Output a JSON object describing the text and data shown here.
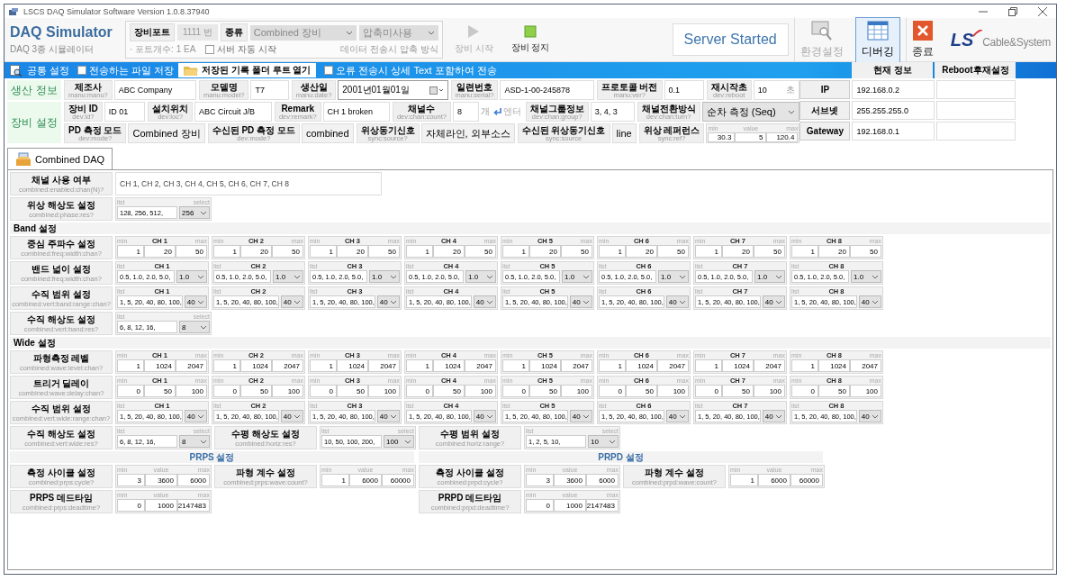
{
  "window": {
    "title": "LSCS DAQ Simulator Software Version 1.0.8.37940"
  },
  "header": {
    "app_title": "DAQ Simulator",
    "app_subtitle": "DAQ 3종 시뮬레이터",
    "port_label": "장비포트",
    "port_value": "1111 번",
    "kind_label": "종류",
    "kind_value": "Combined 장비",
    "compress_value": "압축미사용",
    "port_count": "· 포트개수: 1 EA",
    "auto_start": {
      "label": "서버 자동 시작",
      "checked": false
    },
    "compress_hint": "데이터 전송시 압축 방식",
    "device_buttons": [
      {
        "kind": "start",
        "label": "장비 시작",
        "disabled": true
      },
      {
        "kind": "stop",
        "label": "장비 정지",
        "disabled": false
      }
    ],
    "status": "Server Started",
    "tools": [
      {
        "kind": "settings",
        "label": "환경설정",
        "disabled": true,
        "selected": false
      },
      {
        "kind": "debug",
        "label": "디버깅",
        "disabled": false,
        "selected": true
      },
      {
        "kind": "exit",
        "label": "종료",
        "disabled": false,
        "selected": false
      }
    ],
    "logo": {
      "mark": "LS",
      "text": "Cable&System"
    }
  },
  "toolbar": {
    "title": "공통 설정",
    "save_files": {
      "label": "전송하는 파일 저장",
      "checked": false
    },
    "open_folder": "저장된 기록 폴더 루트 열기",
    "include_text": {
      "label": "오류 전송시 상세 Text 포함하여 전송",
      "checked": false
    }
  },
  "info": {
    "sections": [
      {
        "title": "생산 정보",
        "lines": [
          {
            "fields": [
              {
                "label": "제조사",
                "cmd": "manu:manu?",
                "kind": "text",
                "value": "ABC Company"
              },
              {
                "label": "모델명",
                "cmd": "manu:model?",
                "kind": "text",
                "value": "T7"
              },
              {
                "label": "생산일",
                "cmd": "manu:date?",
                "kind": "date",
                "value": "2001년01월01일"
              },
              {
                "label": "일련번호",
                "cmd": "manu:serial?",
                "kind": "text",
                "value": "ASD-1-00-245878"
              },
              {
                "label": "프로토콜 버전",
                "cmd": "manu:ver?",
                "kind": "text",
                "value": "0.1"
              },
              {
                "label": "재시작초",
                "cmd": "dev:reboot",
                "kind": "unit",
                "value": "10",
                "unit": "초"
              }
            ]
          }
        ]
      },
      {
        "title": "장비 설정",
        "lines": [
          {
            "fields": [
              {
                "label": "장비 ID",
                "cmd": "dev:id?",
                "kind": "text",
                "value": "ID 01"
              },
              {
                "label": "설치위치",
                "cmd": "dev:loc?",
                "kind": "text",
                "value": "ABC Circuit J/B"
              },
              {
                "label": "Remark",
                "cmd": "dev:remark?",
                "kind": "text",
                "value": "CH 1 broken"
              },
              {
                "label": "채널수",
                "cmd": "dev:chan:count?",
                "kind": "count",
                "value": "8",
                "unit": "개",
                "enter": "엔터"
              },
              {
                "label": "채널그룹정보",
                "cmd": "dev:chan:group?",
                "kind": "text",
                "value": "3, 4, 3"
              },
              {
                "label": "채널전환방식",
                "cmd": "dev:chan:turn?",
                "kind": "select",
                "value": "순차 측정 (Seq)"
              }
            ]
          },
          {
            "fields": [
              {
                "label": "PD 측정 모드",
                "cmd": "dev:mode?",
                "kind": "readonly",
                "value": "Combined 장비"
              },
              {
                "label": "수신된 PD 측정 모드",
                "cmd": "dev:mode?",
                "kind": "readonly",
                "value": "combined"
              },
              {
                "label": "위상동기신호",
                "cmd": "sync:source?",
                "kind": "readonly",
                "value": "자체라인, 외부소스"
              },
              {
                "label": "수신된 위상동기신호",
                "cmd": "sync:source",
                "kind": "readonly",
                "value": "line"
              },
              {
                "label": "위상 레퍼런스",
                "cmd": "sync:ref?",
                "kind": "range",
                "widget": {
                  "kind": "range",
                  "captions": [
                    "min",
                    "value",
                    "max"
                  ],
                  "values": [
                    "30.3",
                    "5",
                    "120.4"
                  ]
                }
              }
            ]
          }
        ]
      }
    ]
  },
  "network": {
    "columns": [
      "현재 정보",
      "Reboot후재설정"
    ],
    "rows": [
      {
        "label": "IP",
        "current": "192.168.0.2"
      },
      {
        "label": "서브넷",
        "current": "255.255.255.0"
      },
      {
        "label": "Gateway",
        "current": "192.168.0.1"
      }
    ]
  },
  "tabs": [
    {
      "label": "Combined DAQ",
      "selected": true
    }
  ],
  "combined": {
    "blocks": [
      {
        "kind": "text",
        "label": "채널 사용 여부",
        "cmd": "combined:enabled:chan(N)?",
        "value": "CH 1, CH 2, CH 3, CH 4, CH 5, CH 6, CH 7, CH 8"
      },
      {
        "kind": "pairs",
        "pairs": [
          {
            "label": "위상 해상도 설정",
            "cmd": "combined:phase:res?",
            "widget": {
              "kind": "list",
              "captions": [
                "list",
                "select"
              ],
              "list": "128, 256, 512,",
              "select": "256"
            }
          }
        ]
      },
      {
        "kind": "heading",
        "title": "Band 설정"
      },
      {
        "kind": "channels",
        "label": "중심 주파수 설정",
        "cmd": "combined:freq:width:chan?",
        "channels": [
          {
            "kind": "range",
            "title": "CH 1",
            "captions": [
              "min",
              "max"
            ],
            "values": [
              "1",
              "20",
              "50"
            ]
          },
          {
            "kind": "range",
            "title": "CH 2",
            "captions": [
              "min",
              "max"
            ],
            "values": [
              "1",
              "20",
              "50"
            ]
          },
          {
            "kind": "range",
            "title": "CH 3",
            "captions": [
              "min",
              "max"
            ],
            "values": [
              "1",
              "20",
              "50"
            ]
          },
          {
            "kind": "range",
            "title": "CH 4",
            "captions": [
              "min",
              "max"
            ],
            "values": [
              "1",
              "20",
              "50"
            ]
          },
          {
            "kind": "range",
            "title": "CH 5",
            "captions": [
              "min",
              "max"
            ],
            "values": [
              "1",
              "20",
              "50"
            ]
          },
          {
            "kind": "range",
            "title": "CH 6",
            "captions": [
              "min",
              "max"
            ],
            "values": [
              "1",
              "20",
              "50"
            ]
          },
          {
            "kind": "range",
            "title": "CH 7",
            "captions": [
              "min",
              "max"
            ],
            "values": [
              "1",
              "20",
              "50"
            ]
          },
          {
            "kind": "range",
            "title": "CH 8",
            "captions": [
              "min",
              "max"
            ],
            "values": [
              "1",
              "20",
              "50"
            ]
          }
        ]
      },
      {
        "kind": "channels",
        "label": "밴드 넓이 설정",
        "cmd": "combined:freq:width:chan?",
        "channels": [
          {
            "kind": "list",
            "title": "CH 1",
            "captions": [
              "list"
            ],
            "list": "0.5, 1.0, 2.0, 5.0,",
            "select": "1.0"
          },
          {
            "kind": "list",
            "title": "CH 2",
            "captions": [
              "list"
            ],
            "list": "0.5, 1.0, 2.0, 5.0,",
            "select": "1.0"
          },
          {
            "kind": "list",
            "title": "CH 3",
            "captions": [
              "list"
            ],
            "list": "0.5, 1.0, 2.0, 5.0,",
            "select": "1.0"
          },
          {
            "kind": "list",
            "title": "CH 4",
            "captions": [
              "list"
            ],
            "list": "0.5, 1.0, 2.0, 5.0,",
            "select": "1.0"
          },
          {
            "kind": "list",
            "title": "CH 5",
            "captions": [
              "list"
            ],
            "list": "0.5, 1.0, 2.0, 5.0,",
            "select": "1.0"
          },
          {
            "kind": "list",
            "title": "CH 6",
            "captions": [
              "list"
            ],
            "list": "0.5, 1.0, 2.0, 5.0,",
            "select": "1.0"
          },
          {
            "kind": "list",
            "title": "CH 7",
            "captions": [
              "list"
            ],
            "list": "0.5, 1.0, 2.0, 5.0,",
            "select": "1.0"
          },
          {
            "kind": "list",
            "title": "CH 8",
            "captions": [
              "list"
            ],
            "list": "0.5, 1.0, 2.0, 5.0,",
            "select": "1.0"
          }
        ]
      },
      {
        "kind": "channels",
        "label": "수직 범위 설정",
        "cmd": "combined:vert:band:range:chan?",
        "channels": [
          {
            "kind": "list",
            "title": "CH 1",
            "captions": [
              "list"
            ],
            "list": "1, 5, 20, 40, 80, 100,",
            "select": "40"
          },
          {
            "kind": "list",
            "title": "CH 2",
            "captions": [
              "list"
            ],
            "list": "1, 5, 20, 40, 80, 100,",
            "select": "40"
          },
          {
            "kind": "list",
            "title": "CH 3",
            "captions": [
              "list"
            ],
            "list": "1, 5, 20, 40, 80, 100,",
            "select": "40"
          },
          {
            "kind": "list",
            "title": "CH 4",
            "captions": [
              "list"
            ],
            "list": "1, 5, 20, 40, 80, 100,",
            "select": "40"
          },
          {
            "kind": "list",
            "title": "CH 5",
            "captions": [
              "list"
            ],
            "list": "1, 5, 20, 40, 80, 100,",
            "select": "40"
          },
          {
            "kind": "list",
            "title": "CH 6",
            "captions": [
              "list"
            ],
            "list": "1, 5, 20, 40, 80, 100,",
            "select": "40"
          },
          {
            "kind": "list",
            "title": "CH 7",
            "captions": [
              "list"
            ],
            "list": "1, 5, 20, 40, 80, 100,",
            "select": "40"
          },
          {
            "kind": "list",
            "title": "CH 8",
            "captions": [
              "list"
            ],
            "list": "1, 5, 20, 40, 80, 100,",
            "select": "40"
          }
        ]
      },
      {
        "kind": "pairs",
        "pairs": [
          {
            "label": "수직 해상도 설정",
            "cmd": "combined:vert:band:res?",
            "widget": {
              "kind": "list",
              "captions": [
                "list",
                "select"
              ],
              "list": "6, 8, 12, 16,",
              "select": "8"
            }
          }
        ]
      },
      {
        "kind": "heading",
        "title": "Wide 설정"
      },
      {
        "kind": "channels",
        "label": "파형측정 레벨",
        "cmd": "combined:wave:level:chan?",
        "channels": [
          {
            "kind": "range",
            "title": "CH 1",
            "captions": [
              "min",
              "max"
            ],
            "values": [
              "1",
              "1024",
              "2047"
            ]
          },
          {
            "kind": "range",
            "title": "CH 2",
            "captions": [
              "min",
              "max"
            ],
            "values": [
              "1",
              "1024",
              "2047"
            ]
          },
          {
            "kind": "range",
            "title": "CH 3",
            "captions": [
              "min",
              "max"
            ],
            "values": [
              "1",
              "1024",
              "2047"
            ]
          },
          {
            "kind": "range",
            "title": "CH 4",
            "captions": [
              "min",
              "max"
            ],
            "values": [
              "1",
              "1024",
              "2047"
            ]
          },
          {
            "kind": "range",
            "title": "CH 5",
            "captions": [
              "min",
              "max"
            ],
            "values": [
              "1",
              "1024",
              "2047"
            ]
          },
          {
            "kind": "range",
            "title": "CH 6",
            "captions": [
              "min",
              "max"
            ],
            "values": [
              "1",
              "1024",
              "2047"
            ]
          },
          {
            "kind": "range",
            "title": "CH 7",
            "captions": [
              "min",
              "max"
            ],
            "values": [
              "1",
              "1024",
              "2047"
            ]
          },
          {
            "kind": "range",
            "title": "CH 8",
            "captions": [
              "min",
              "max"
            ],
            "values": [
              "1",
              "1024",
              "2047"
            ]
          }
        ]
      },
      {
        "kind": "channels",
        "label": "트리거 딜레이",
        "cmd": "combined:wave:delay:chan?",
        "channels": [
          {
            "kind": "range",
            "title": "CH 1",
            "captions": [
              "min",
              "max"
            ],
            "values": [
              "0",
              "50",
              "100"
            ]
          },
          {
            "kind": "range",
            "title": "CH 2",
            "captions": [
              "min",
              "max"
            ],
            "values": [
              "0",
              "50",
              "100"
            ]
          },
          {
            "kind": "range",
            "title": "CH 3",
            "captions": [
              "min",
              "max"
            ],
            "values": [
              "0",
              "50",
              "100"
            ]
          },
          {
            "kind": "range",
            "title": "CH 4",
            "captions": [
              "min",
              "max"
            ],
            "values": [
              "0",
              "50",
              "100"
            ]
          },
          {
            "kind": "range",
            "title": "CH 5",
            "captions": [
              "min",
              "max"
            ],
            "values": [
              "0",
              "50",
              "100"
            ]
          },
          {
            "kind": "range",
            "title": "CH 6",
            "captions": [
              "min",
              "max"
            ],
            "values": [
              "0",
              "50",
              "100"
            ]
          },
          {
            "kind": "range",
            "title": "CH 7",
            "captions": [
              "min",
              "max"
            ],
            "values": [
              "0",
              "50",
              "100"
            ]
          },
          {
            "kind": "range",
            "title": "CH 8",
            "captions": [
              "min",
              "max"
            ],
            "values": [
              "0",
              "50",
              "100"
            ]
          }
        ]
      },
      {
        "kind": "channels",
        "label": "수직 범위 설정",
        "cmd": "combined:vert:wide:range:chan?",
        "channels": [
          {
            "kind": "list",
            "title": "CH 1",
            "captions": [
              "list"
            ],
            "list": "1, 5, 20, 40, 80, 100,",
            "select": "40"
          },
          {
            "kind": "list",
            "title": "CH 2",
            "captions": [
              "list"
            ],
            "list": "1, 5, 20, 40, 80, 100,",
            "select": "40"
          },
          {
            "kind": "list",
            "title": "CH 3",
            "captions": [
              "list"
            ],
            "list": "1, 5, 20, 40, 80, 100,",
            "select": "40"
          },
          {
            "kind": "list",
            "title": "CH 4",
            "captions": [
              "list"
            ],
            "list": "1, 5, 20, 40, 80, 100,",
            "select": "40"
          },
          {
            "kind": "list",
            "title": "CH 5",
            "captions": [
              "list"
            ],
            "list": "1, 5, 20, 40, 80, 100,",
            "select": "40"
          },
          {
            "kind": "list",
            "title": "CH 6",
            "captions": [
              "list"
            ],
            "list": "1, 5, 20, 40, 80, 100,",
            "select": "40"
          },
          {
            "kind": "list",
            "title": "CH 7",
            "captions": [
              "list"
            ],
            "list": "1, 5, 20, 40, 80, 100,",
            "select": "40"
          },
          {
            "kind": "list",
            "title": "CH 8",
            "captions": [
              "list"
            ],
            "list": "1, 5, 20, 40, 80, 100,",
            "select": "40"
          }
        ]
      },
      {
        "kind": "pairs",
        "pairs": [
          {
            "label": "수직 해상도 설정",
            "cmd": "combined:vert:wide:res?",
            "widget": {
              "kind": "list",
              "captions": [
                "list",
                "select"
              ],
              "list": "6, 8, 12, 16,",
              "select": "8"
            }
          },
          {
            "label": "수평 해상도 설정",
            "cmd": "combined:horiz:res?",
            "widget": {
              "kind": "list",
              "captions": [
                "list",
                "select"
              ],
              "list": "10, 50, 100, 200,",
              "select": "100"
            }
          },
          {
            "label": "수평 범위 설정",
            "cmd": "combined:horiz:range?",
            "widget": {
              "kind": "list",
              "captions": [
                "list",
                "select"
              ],
              "list": "1, 2, 5, 10,",
              "select": "10"
            }
          }
        ]
      },
      {
        "kind": "halves",
        "halves": [
          {
            "title": "PRPS 설정",
            "rows": [
              [
                {
                  "label": "측정 사이클 설정",
                  "cmd": "combined:prps:cycle?",
                  "widget": {
                    "kind": "range",
                    "captions": [
                      "min",
                      "value",
                      "max"
                    ],
                    "values": [
                      "3",
                      "3600",
                      "6000"
                    ]
                  }
                },
                {
                  "label": "파형 계수 설정",
                  "cmd": "combined:prps:wave:count?",
                  "widget": {
                    "kind": "range",
                    "captions": [
                      "min",
                      "value",
                      "max"
                    ],
                    "values": [
                      "1",
                      "6000",
                      "60000"
                    ]
                  }
                }
              ],
              [
                {
                  "label": "PRPS 데드타임",
                  "cmd": "combined:prps:deadtime?",
                  "widget": {
                    "kind": "range",
                    "captions": [
                      "min",
                      "value",
                      "max"
                    ],
                    "values": [
                      "0",
                      "1000",
                      "2147483"
                    ]
                  }
                }
              ]
            ]
          },
          {
            "title": "PRPD 설정",
            "rows": [
              [
                {
                  "label": "측정 사이클 설정",
                  "cmd": "combined:prpd:cycle?",
                  "widget": {
                    "kind": "range",
                    "captions": [
                      "min",
                      "value",
                      "max"
                    ],
                    "values": [
                      "3",
                      "3600",
                      "6000"
                    ]
                  }
                },
                {
                  "label": "파형 계수 설정",
                  "cmd": "combined:prpd:wave:count?",
                  "widget": {
                    "kind": "range",
                    "captions": [
                      "min",
                      "value",
                      "max"
                    ],
                    "values": [
                      "1",
                      "6000",
                      "60000"
                    ]
                  }
                }
              ],
              [
                {
                  "label": "PRPD 데드타임",
                  "cmd": "combined:prpd:deadtime?",
                  "widget": {
                    "kind": "range",
                    "captions": [
                      "min",
                      "value",
                      "max"
                    ],
                    "values": [
                      "0",
                      "1000",
                      "2147483"
                    ]
                  }
                }
              ]
            ]
          }
        ]
      }
    ]
  }
}
